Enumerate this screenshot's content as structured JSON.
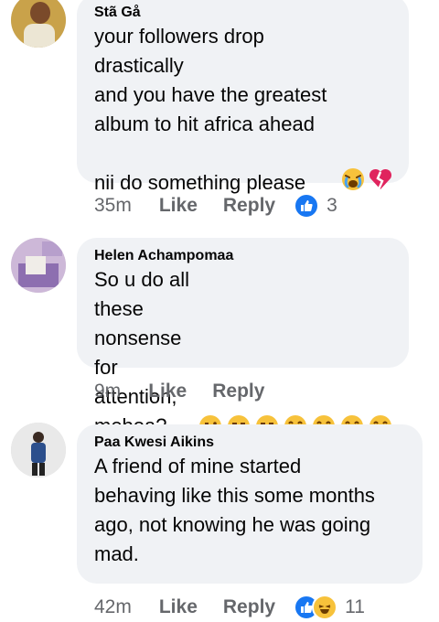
{
  "comments": [
    {
      "author": "Stã Gå",
      "text": "your followers drop drastically\nand you have the greatest\nalbum to hit africa ahead\n\nnii do something please",
      "time": "35m",
      "like_label": "Like",
      "reply_label": "Reply",
      "reaction_count": "3",
      "reactions": [
        "like-icon"
      ]
    },
    {
      "author": "Helen Achampomaa",
      "text": "So u do all these nonsense for\nattention,\nmeboa?",
      "time": "9m",
      "like_label": "Like",
      "reply_label": "Reply"
    },
    {
      "author": "Paa Kwesi Aikins",
      "text": "A friend of mine started\nbehaving like this some months\nago, not knowing he was going\nmad.",
      "time": "42m",
      "like_label": "Like",
      "reply_label": "Reply",
      "reaction_count": "11",
      "reactions": [
        "like-icon",
        "haha-icon"
      ]
    }
  ],
  "colors": {
    "bubble": "#f0f2f5",
    "meta": "#65676b",
    "like_blue": "#1877f2",
    "emoji_yellow": "#f7c23b"
  }
}
